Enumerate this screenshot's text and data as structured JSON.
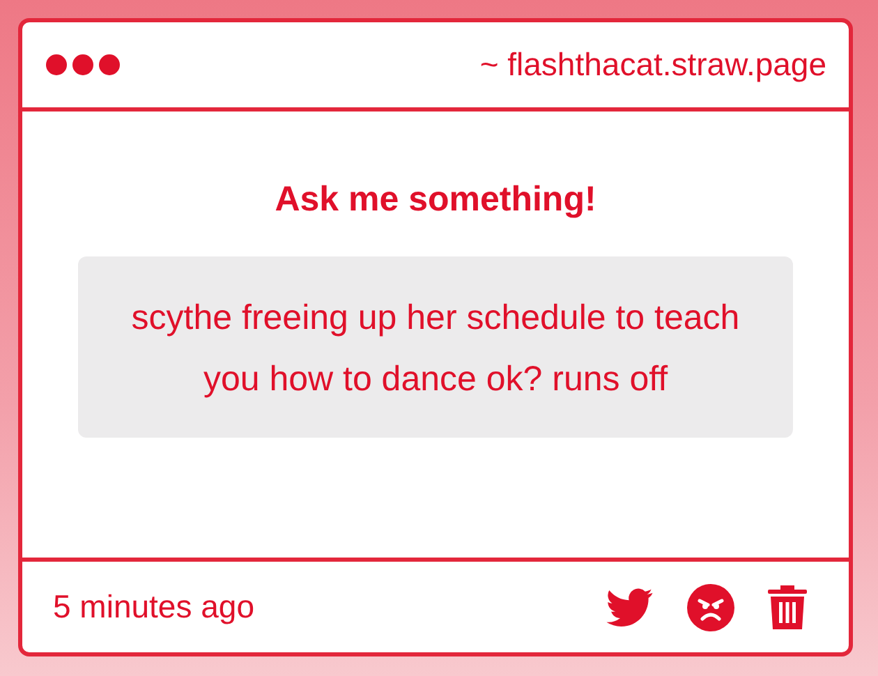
{
  "header": {
    "url": "~ flashthacat.straw.page"
  },
  "prompt": "Ask me something!",
  "message": "scythe freeing up her schedule to teach you how to dance ok? runs off",
  "footer": {
    "time": "5 minutes ago"
  }
}
